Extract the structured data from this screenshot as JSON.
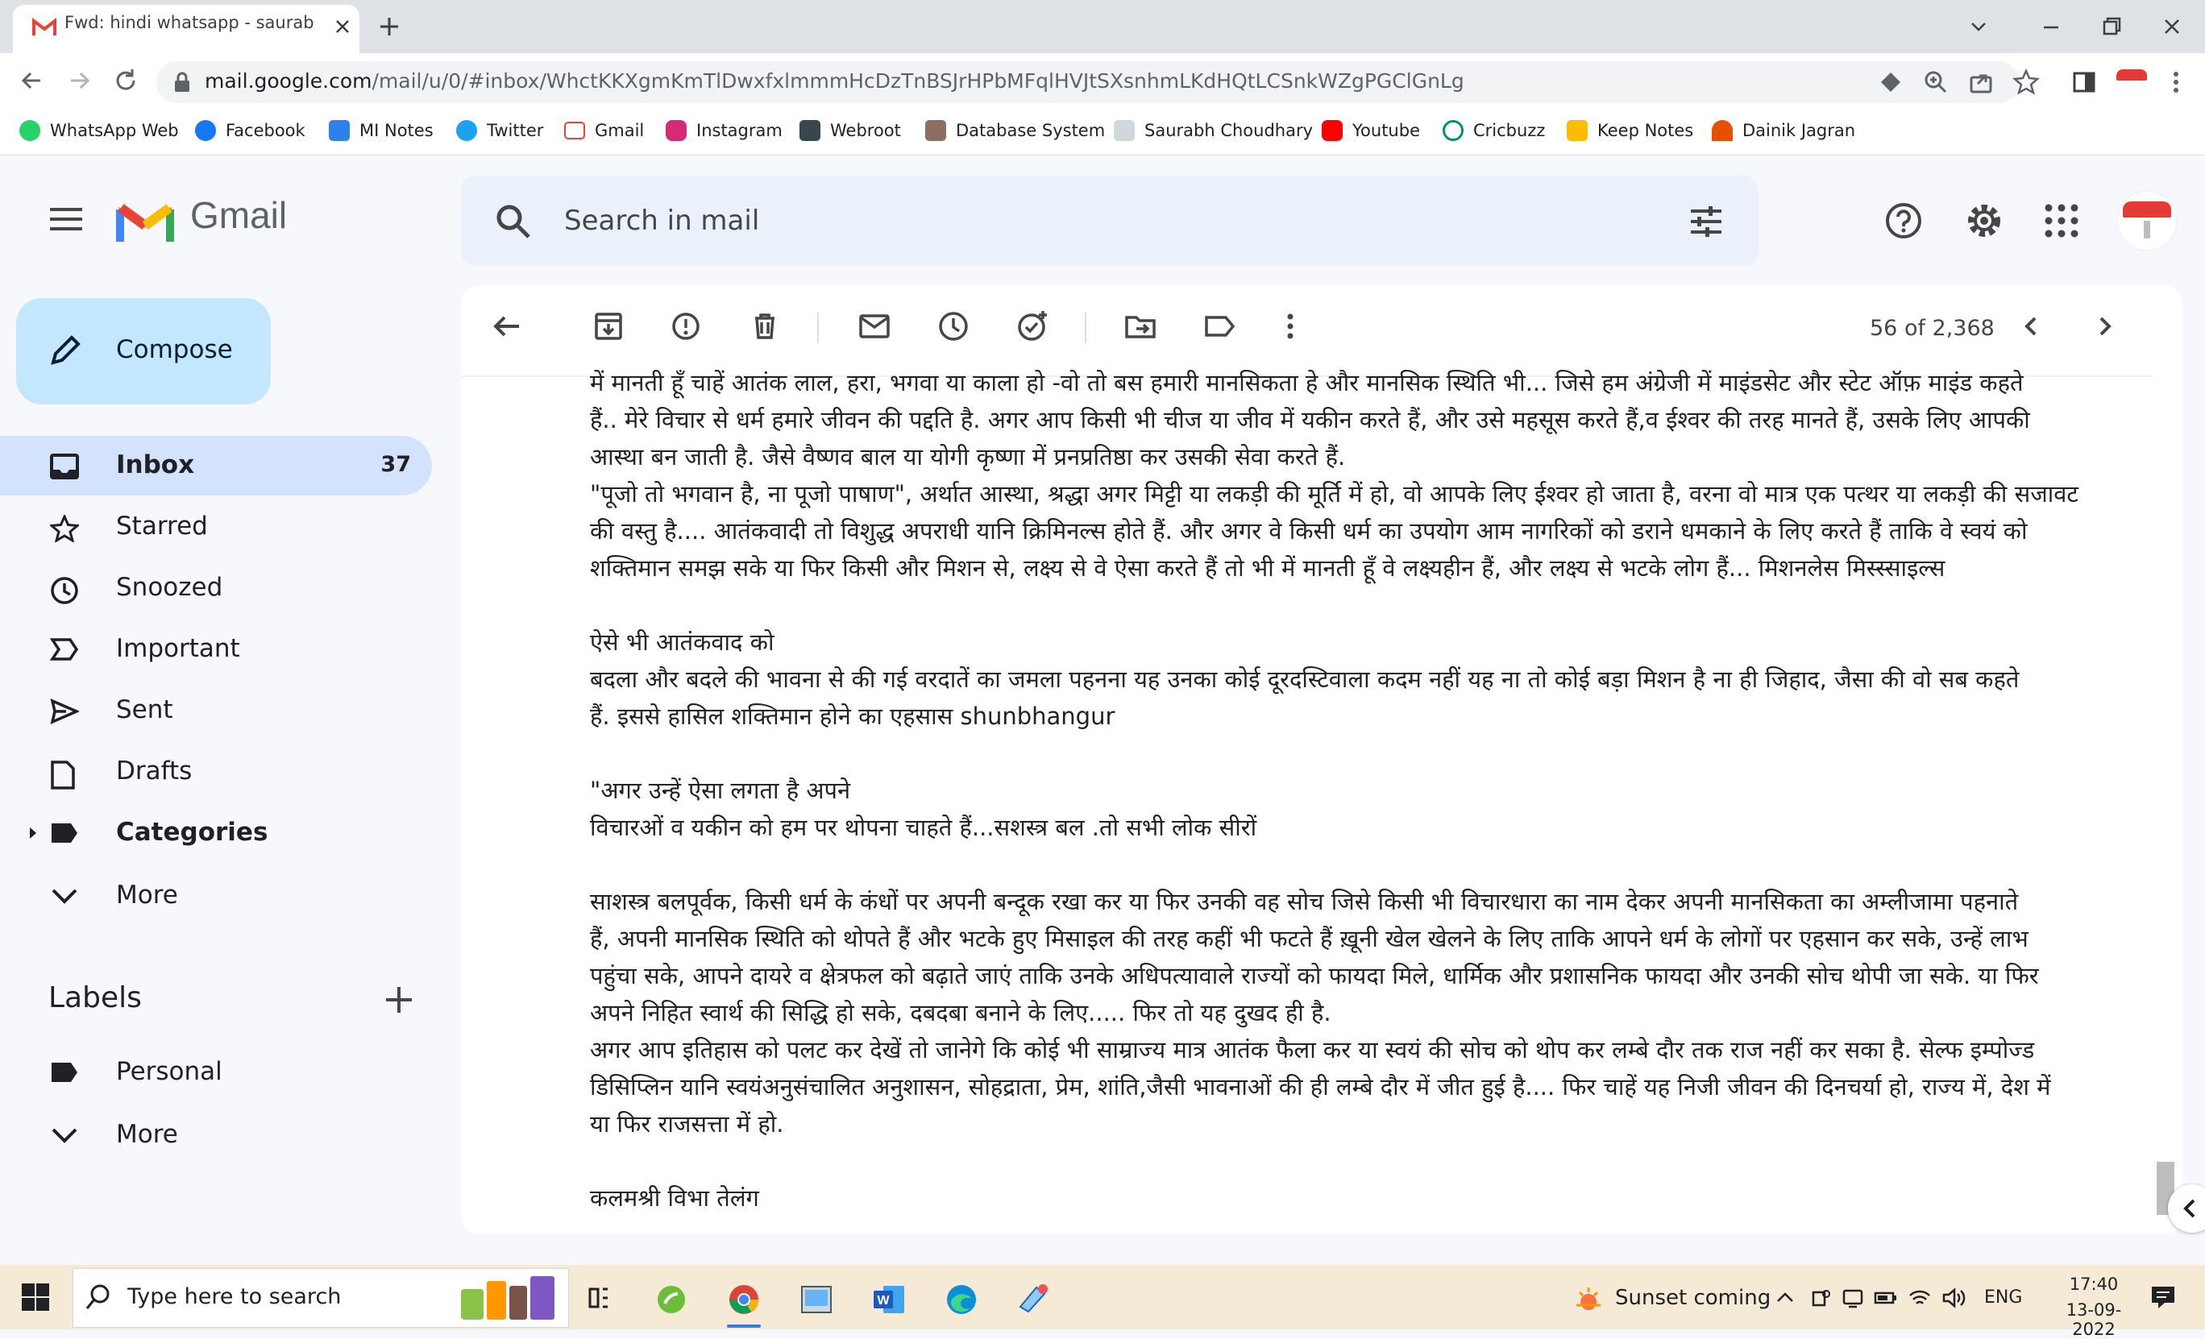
{
  "browser": {
    "tab_title": "Fwd: hindi whatsapp - saurabhch",
    "url_host": "mail.google.com",
    "url_path": "/mail/u/0/#inbox/WhctKKXgmKmTlDwxfxlmmmHcDzTnBSJrHPbMFqlHVJtSXsnhmLKdHQtLCSnkWZgPGClGnLg",
    "bookmarks": [
      "WhatsApp Web",
      "Facebook",
      "MI Notes",
      "Twitter",
      "Gmail",
      "Instagram",
      "Webroot",
      "Database System",
      "Saurabh Choudhary",
      "Youtube",
      "Cricbuzz",
      "Keep Notes",
      "Dainik Jagran"
    ]
  },
  "gmail": {
    "logo_text": "Gmail",
    "search_placeholder": "Search in mail",
    "compose_label": "Compose",
    "nav": [
      {
        "label": "Inbox",
        "count": "37"
      },
      {
        "label": "Starred"
      },
      {
        "label": "Snoozed"
      },
      {
        "label": "Important"
      },
      {
        "label": "Sent"
      },
      {
        "label": "Drafts"
      },
      {
        "label": "Categories"
      },
      {
        "label": "More"
      }
    ],
    "labels_heading": "Labels",
    "labels": [
      {
        "label": "Personal"
      },
      {
        "label": "More"
      }
    ],
    "pager": "56 of 2,368"
  },
  "email": {
    "lines": [
      "में मानती हूँ चाहें आतंक लाल, हरा, भगवा या काला हो -वो तो बस हमारी मानसिकता हे और मानसिक स्थिति भी... जिसे हम अंग्रेजी में माइंडसेट और स्टेट ऑफ़ माइंड कहते",
      "हैं.. मेरे विचार से धर्म हमारे जीवन की पद्दति है. अगर आप किसी भी चीज या जीव में यकीन करते हैं, और उसे महसूस करते हैं,व ईश्वर की तरह मानते हैं, उसके लिए आपकी",
      "आस्था बन जाती है. जैसे वैष्णव बाल या योगी कृष्णा में  प्रनप्रतिष्ठा कर उसकी सेवा करते हैं.",
      "\"पूजो तो भगवान है, ना पूजो पाषाण\", अर्थात आस्था, श्रद्धा अगर मिट्टी या लकड़ी की मूर्ति में हो, वो आपके लिए ईश्वर हो जाता है, वरना वो मात्र एक पत्थर या लकड़ी की सजावट",
      "की वस्तु है.... आतंकवादी तो विशुद्ध अपराधी यानि क्रिमिनल्स होते हैं. और अगर वे किसी धर्म का उपयोग आम नागरिकों को डराने धमकाने के लिए करते हैं ताकि वे स्वयं को",
      "शक्तिमान समझ सके या फिर किसी और मिशन से, लक्ष्य से वे ऐसा करते हैं तो भी में मानती हूँ वे लक्ष्यहीन हैं, और लक्ष्य से भटके लोग हैं... मिशनलेस मिस्स्साइल्स",
      "",
      "ऐसे भी आतंकवाद को",
      "बदला और बदले की भावना से की गई वरदातें का जमला पहनना यह उनका कोई दूरदस्टिवाला कदम नहीं यह ना तो कोई बड़ा मिशन है ना ही जिहाद, जैसा की वो सब कहते",
      "हैं. इससे हासिल शक्तिमान होने का एहसास shunbhangur",
      "",
      "\"अगर उन्हें ऐसा लगता है अपने",
      "विचारओं व यकीन  को हम पर थोपना चाहते हैं...सशस्त्र बल .तो सभी लोक सीरों",
      "",
      "साशस्त्र बलपूर्वक, किसी धर्म के कंधों पर अपनी बन्दूक रखा कर या फिर उनकी वह सोच जिसे किसी भी विचारधारा का नाम देकर अपनी मानसिकता का अम्लीजामा पहनाते",
      "हैं, अपनी मानसिक स्थिति को थोपते हैं और भटके हुए मिसाइल की तरह कहीं भी फटते हैं ख़ूनी खेल खेलने के लिए ताकि आपने धर्म के लोगों पर एहसान कर सके, उन्हें लाभ",
      "पहुंचा सके, आपने दायरे व क्षेत्रफल को बढ़ाते जाएं ताकि उनके अधिपत्यावाले राज्यों को फायदा मिले, धार्मिक और प्रशासनिक फायदा और उनकी सोच थोपी जा सके. या फिर",
      "अपने निहित स्वार्थ की सिद्धि हो सके, दबदबा बनाने के लिए..... फिर तो यह दुखद ही है.",
      "अगर आप इतिहास को पलट कर देखें तो जानेगे कि कोई भी साम्राज्य मात्र आतंक फैला कर या स्वयं की सोच को थोप कर लम्बे दौर तक राज नहीं कर सका है. सेल्फ इम्पोज्ड",
      "डिसिप्लिन यानि स्वयंअनुसंचालित अनुशासन, सोहद्राता, प्रेम, शांति,जैसी भावनाओं की ही लम्बे दौर में जीत हुई है.... फिर चाहें यह निजी जीवन की दिनचर्या हो, राज्य में, देश में",
      "या फिर राजसत्ता में हो.",
      "",
      "कलमश्री विभा तेलंग"
    ]
  },
  "taskbar": {
    "search_placeholder": "Type here to search",
    "weather": "Sunset coming",
    "language": "ENG",
    "time": "17:40",
    "date": "13-09-2022"
  }
}
